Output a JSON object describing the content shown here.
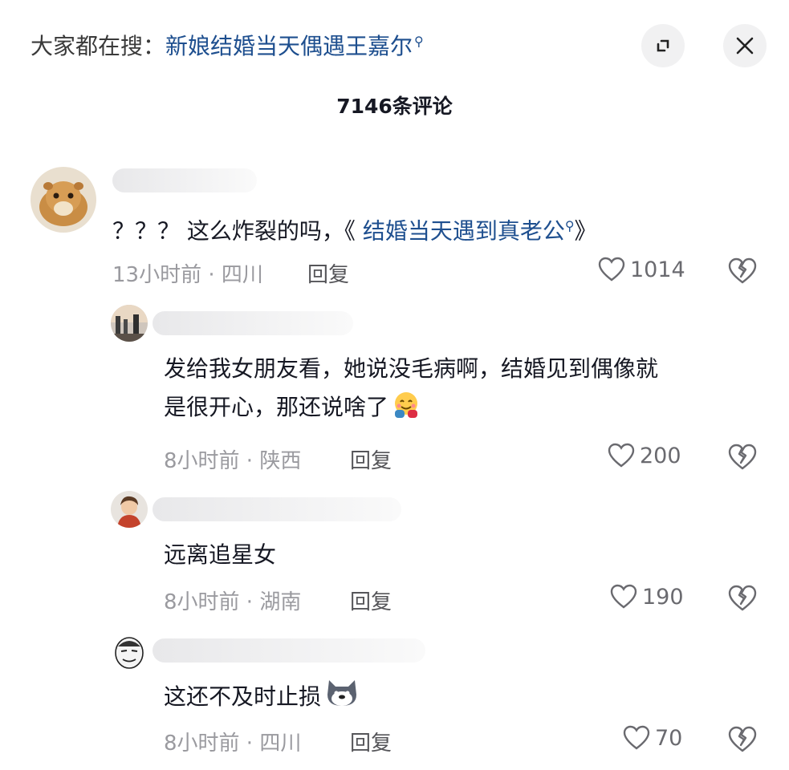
{
  "header": {
    "trend_prefix": "大家都在搜：",
    "trend_keyword": "新娘结婚当天偶遇王嘉尔",
    "comment_count": "7146条评论"
  },
  "comments": [
    {
      "text_plain": "？？？ 这么炸裂的吗，《",
      "text_link": "结婚当天遇到真老公",
      "text_tail": "》",
      "time_location": "13小时前 · 四川",
      "reply_label": "回复",
      "likes": "1014"
    },
    {
      "text_line1": "发给我女朋友看，她说没毛病啊，结婚见到偶像就",
      "text_line2": "是很开心，那还说啥了",
      "time_location": "8小时前 · 陕西",
      "reply_label": "回复",
      "likes": "200"
    },
    {
      "text": "远离追星女",
      "time_location": "8小时前 · 湖南",
      "reply_label": "回复",
      "likes": "190"
    },
    {
      "text": "这还不及时止损",
      "time_location": "8小时前 · 四川",
      "reply_label": "回复",
      "likes": "70"
    }
  ],
  "colors": {
    "link": "#1e4f8f",
    "meta": "#9a9a9f",
    "text": "#161823"
  },
  "icons": [
    "search-icon",
    "expand-icon",
    "close-icon",
    "heart-icon",
    "broken-heart-icon",
    "hug-emoji",
    "doge-emoji"
  ]
}
